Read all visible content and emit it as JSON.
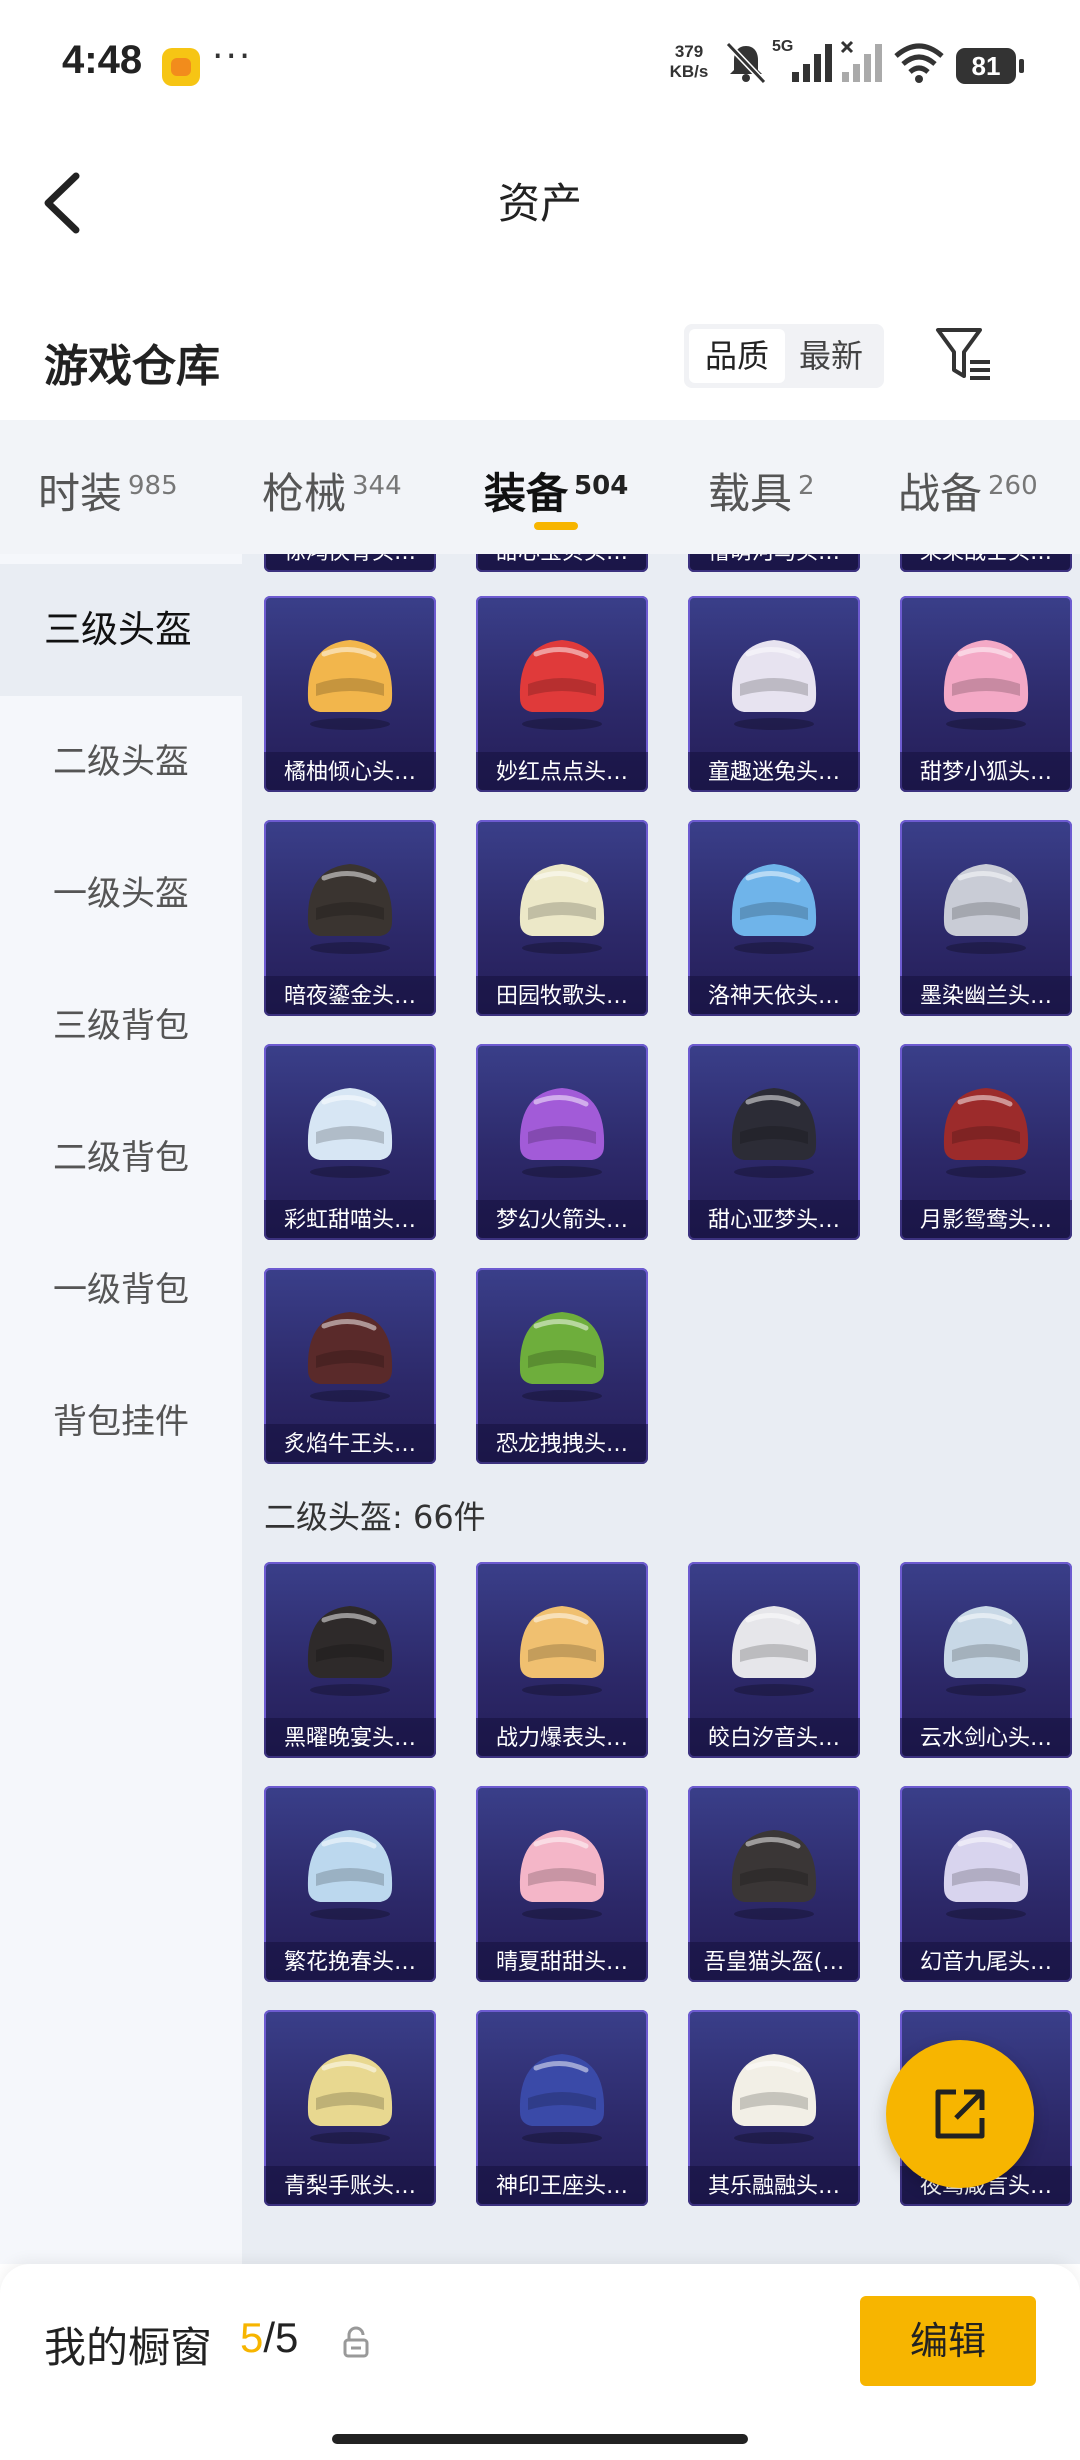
{
  "status_bar": {
    "time": "4:48",
    "dots": "···",
    "net_speed_value": "379",
    "net_speed_unit": "KB/s",
    "network": "5G",
    "battery": "81"
  },
  "nav": {
    "title": "资产"
  },
  "warehouse": {
    "title": "游戏仓库",
    "sort_options": [
      "品质",
      "最新"
    ],
    "sort_selected": "品质"
  },
  "categories": [
    {
      "label": "时装",
      "count": "985"
    },
    {
      "label": "枪械",
      "count": "344"
    },
    {
      "label": "装备",
      "count": "504"
    },
    {
      "label": "载具",
      "count": "2"
    },
    {
      "label": "战备",
      "count": "260"
    }
  ],
  "active_category": "装备",
  "sidebar": {
    "items": [
      "三级头盔",
      "二级头盔",
      "一级头盔",
      "三级背包",
      "二级背包",
      "一级背包",
      "背包挂件"
    ],
    "active": "三级头盔"
  },
  "grid": {
    "partial_top": [
      "惊鸿侠骨头…",
      "甜心宝贝头…",
      "懵萌河马头…",
      "呆呆战士头…"
    ],
    "level3": [
      {
        "name": "橘柚倾心头…",
        "color": "#f2b64c"
      },
      {
        "name": "妙红点点头…",
        "color": "#e03a3a"
      },
      {
        "name": "童趣迷兔头…",
        "color": "#e7e3f0"
      },
      {
        "name": "甜梦小狐头…",
        "color": "#f4a9c6"
      },
      {
        "name": "暗夜鎏金头…",
        "color": "#3a3430"
      },
      {
        "name": "田园牧歌头…",
        "color": "#ece8c8"
      },
      {
        "name": "洛神天依头…",
        "color": "#6fb4ea"
      },
      {
        "name": "墨染幽兰头…",
        "color": "#c9ccd6"
      },
      {
        "name": "彩虹甜喵头…",
        "color": "#d7e6f4"
      },
      {
        "name": "梦幻火箭头…",
        "color": "#a25bd8"
      },
      {
        "name": "甜心亚梦头…",
        "color": "#2c2c36"
      },
      {
        "name": "月影鸳鸯头…",
        "color": "#9c2b2b"
      },
      {
        "name": "炙焰牛王头…",
        "color": "#5a2a2a"
      },
      {
        "name": "恐龙拽拽头…",
        "color": "#6eae3c"
      }
    ],
    "level2_label": "二级头盔: 66件",
    "level2": [
      {
        "name": "黑曜晚宴头…",
        "color": "#2e2a2a"
      },
      {
        "name": "战力爆表头…",
        "color": "#f0c070"
      },
      {
        "name": "皎白汐音头…",
        "color": "#e6e6ea"
      },
      {
        "name": "云水剑心头…",
        "color": "#c8d8e6"
      },
      {
        "name": "繁花挽春头…",
        "color": "#bcd8ee"
      },
      {
        "name": "晴夏甜甜头…",
        "color": "#f4b6c8"
      },
      {
        "name": "吾皇猫头盔(…",
        "color": "#3a3636"
      },
      {
        "name": "幻音九尾头…",
        "color": "#d8d4ee"
      },
      {
        "name": "青梨手账头…",
        "color": "#e8d890"
      },
      {
        "name": "神印王座头…",
        "color": "#3a4aa8"
      },
      {
        "name": "其乐融融头…",
        "color": "#f2efe6"
      },
      {
        "name": "夜莺箴言头…",
        "color": "#d7d0e2"
      }
    ]
  },
  "bottom_bar": {
    "label": "我的橱窗",
    "current": "5",
    "total": "/5",
    "edit_label": "编辑"
  },
  "colors": {
    "accent": "#f7b500",
    "card_border": "#6d5bd0"
  }
}
